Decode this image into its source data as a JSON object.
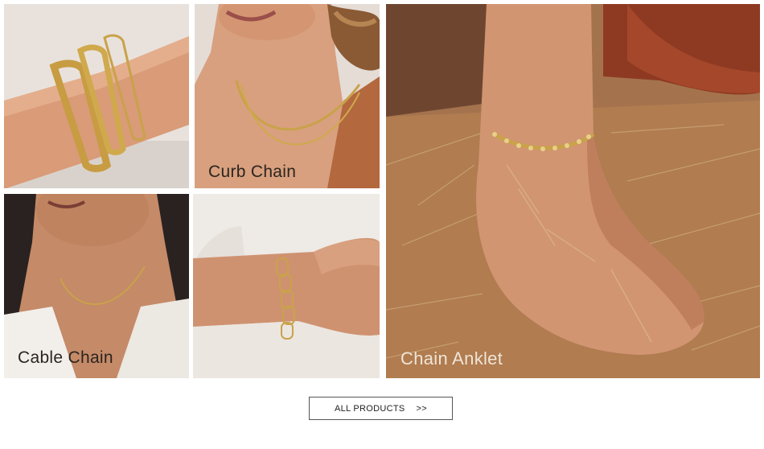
{
  "gallery": {
    "tiles": [
      {
        "label": "",
        "subject": "wrist with three gold curb chain bracelets"
      },
      {
        "label": "Curb Chain",
        "subject": "neck with layered gold curb chain necklaces"
      },
      {
        "label": "Cable Chain",
        "subject": "neck with thin gold cable chain necklace"
      },
      {
        "label": "",
        "subject": "wrist with gold paperclip chain bracelet"
      },
      {
        "label": "Chain Anklet",
        "subject": "bare foot with gold chain anklet in dry grass"
      }
    ]
  },
  "cta": {
    "label": "ALL PRODUCTS",
    "arrows": ">>"
  },
  "colors": {
    "skin": "#d9a27f",
    "gold": "#c9a24a",
    "grass": "#a8744a",
    "dress": "#9c3a20",
    "background": "#ffffff"
  }
}
